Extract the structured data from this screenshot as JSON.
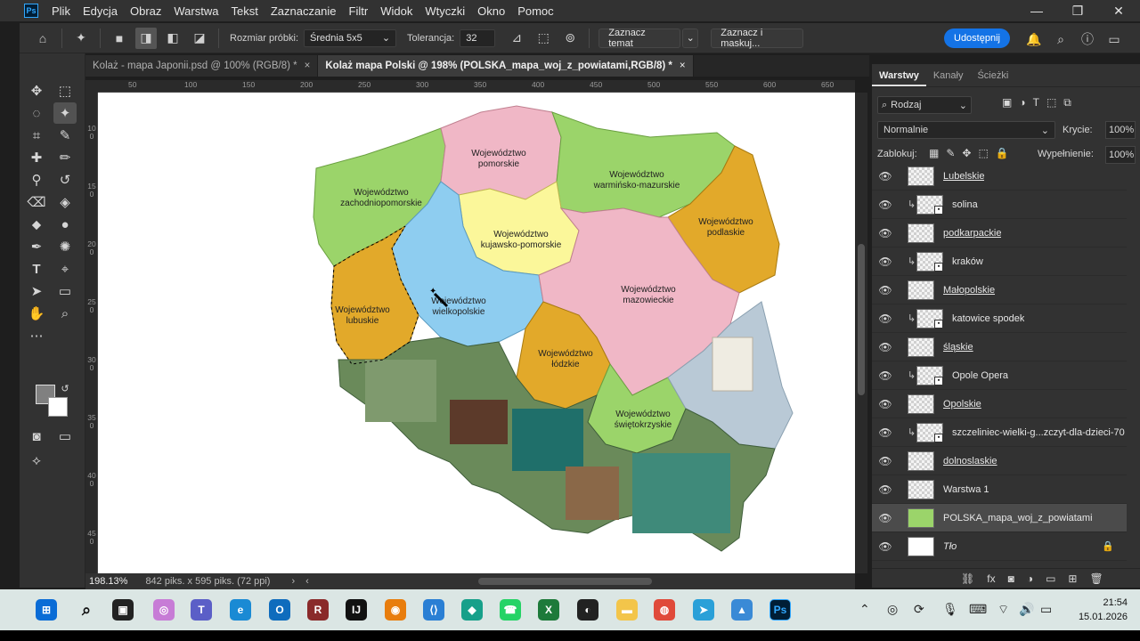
{
  "app": {
    "logo": "Ps"
  },
  "menu": [
    "Plik",
    "Edycja",
    "Obraz",
    "Warstwa",
    "Tekst",
    "Zaznaczanie",
    "Filtr",
    "Widok",
    "Wtyczki",
    "Okno",
    "Pomoc"
  ],
  "window_controls": {
    "minimize": "—",
    "restore": "❐",
    "close": "✕"
  },
  "options": {
    "sample_size_label": "Rozmiar próbki:",
    "sample_size_value": "Średnia 5x5",
    "tolerance_label": "Tolerancja:",
    "tolerance_value": "32",
    "select_subject": "Zaznacz temat",
    "select_mask": "Zaznacz i maskuj...",
    "share": "Udostępnij"
  },
  "tabs": [
    {
      "label": "Kolaż - mapa Japonii.psd @ 100% (RGB/8) *",
      "close": "×"
    },
    {
      "label": "Kolaż mapa Polski @ 198% (POLSKA_mapa_woj_z_powiatami,RGB/8) *",
      "close": "×"
    }
  ],
  "ruler_top": [
    "50",
    "100",
    "150",
    "200",
    "250",
    "300",
    "350",
    "400",
    "450",
    "500",
    "550",
    "600",
    "650"
  ],
  "ruler_left": [
    "100",
    "150",
    "200",
    "250",
    "300",
    "350",
    "400",
    "450"
  ],
  "map_labels": {
    "zachodniopomorskie": [
      "Województwo",
      "zachodniopomorskie"
    ],
    "pomorskie": [
      "Województwo",
      "pomorskie"
    ],
    "warminsko": [
      "Województwo",
      "warmińsko-mazurskie"
    ],
    "podlaskie": [
      "Województwo",
      "podlaskie"
    ],
    "kujawsko": [
      "Województwo",
      "kujawsko-pomorskie"
    ],
    "wielkopolskie": [
      "Województwo",
      "wielkopolskie"
    ],
    "lubuskie": [
      "Województwo",
      "lubuskie"
    ],
    "mazowieckie": [
      "Województwo",
      "mazowieckie"
    ],
    "lodzkie": [
      "Województwo",
      "łódzkie"
    ],
    "swietokrzyskie": [
      "Województwo",
      "świętokrzyskie"
    ]
  },
  "status": {
    "zoom": "198.13%",
    "doc_size": "842 piks. x 595 piks. (72 ppi)",
    "arrow": "›",
    "left_arrow": "‹"
  },
  "panel": {
    "tabs": [
      "Warstwy",
      "Kanały",
      "Ścieżki"
    ],
    "filter_kind": "Rodzaj",
    "blend_mode": "Normalnie",
    "opacity_label": "Krycie:",
    "opacity_value": "100%",
    "lock_label": "Zablokuj:",
    "fill_label": "Wypełnienie:",
    "fill_value": "100%",
    "layers": [
      {
        "name": "Lubelskie",
        "style": "ul",
        "clip": false,
        "smart": false,
        "selected": false
      },
      {
        "name": "solina",
        "style": "",
        "clip": true,
        "smart": true,
        "selected": false
      },
      {
        "name": "podkarpackie",
        "style": "ul",
        "clip": false,
        "smart": false,
        "selected": false
      },
      {
        "name": "kraków",
        "style": "",
        "clip": true,
        "smart": true,
        "selected": false
      },
      {
        "name": "Małopolskie",
        "style": "ul",
        "clip": false,
        "smart": false,
        "selected": false
      },
      {
        "name": "katowice spodek",
        "style": "",
        "clip": true,
        "smart": true,
        "selected": false
      },
      {
        "name": "śląskie",
        "style": "ul",
        "clip": false,
        "smart": false,
        "selected": false
      },
      {
        "name": "Opole  Opera",
        "style": "",
        "clip": true,
        "smart": true,
        "selected": false
      },
      {
        "name": "Opolskie",
        "style": "ul",
        "clip": false,
        "smart": false,
        "selected": false
      },
      {
        "name": "szczeliniec-wielki-g...zczyt-dla-dzieci-70",
        "style": "",
        "clip": true,
        "smart": true,
        "selected": false
      },
      {
        "name": "dolnoslaskie",
        "style": "ul",
        "clip": false,
        "smart": false,
        "selected": false
      },
      {
        "name": "Warstwa 1",
        "style": "",
        "clip": false,
        "smart": false,
        "selected": false
      },
      {
        "name": "POLSKA_mapa_woj_z_powiatami",
        "style": "",
        "clip": false,
        "smart": false,
        "selected": true
      },
      {
        "name": "Tło",
        "style": "it",
        "clip": false,
        "smart": false,
        "selected": false,
        "locked": true
      }
    ]
  },
  "clock": {
    "time": "21:54",
    "date": "15.01.2026"
  },
  "colors": {
    "zachodnio": "#9bd46a",
    "pomorskie": "#f0b7c6",
    "warminsko": "#9bd46a",
    "podlaskie": "#e2a92a",
    "kujawsko": "#fbf79a",
    "wielkopolskie": "#8ecdf0",
    "lubuskie": "#e2a92a",
    "mazowieckie": "#f0b7c6",
    "lodzkie": "#e2a92a",
    "swietokrzyskie": "#9bd46a",
    "accent": "#1473e6"
  }
}
